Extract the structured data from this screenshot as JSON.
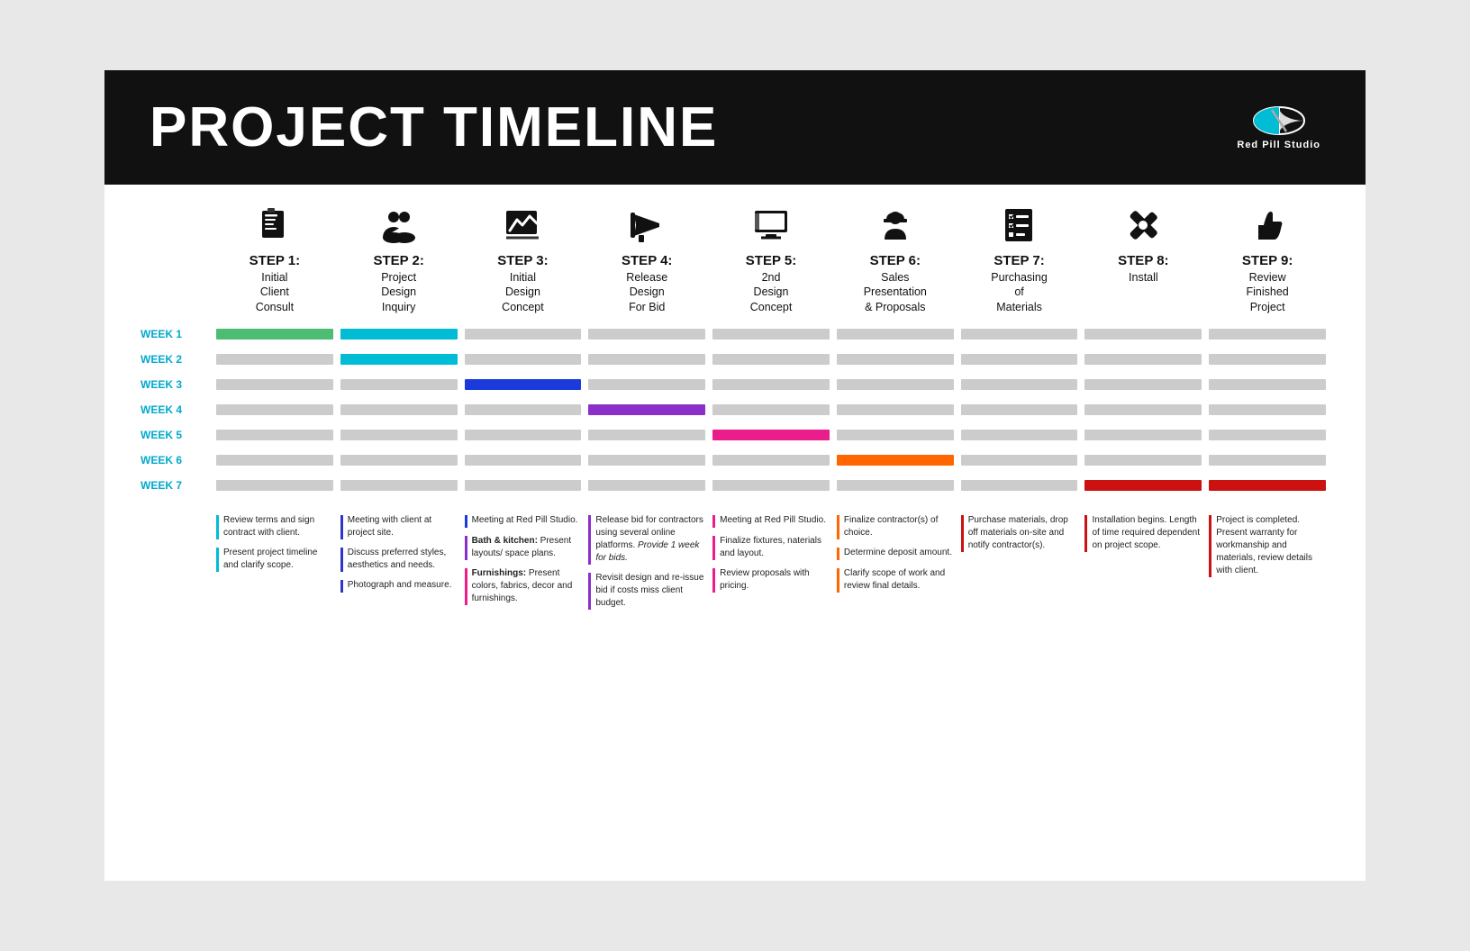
{
  "header": {
    "title": "PROJECT TIMELINE",
    "logo_text": "Red Pill Studio"
  },
  "steps": [
    {
      "id": "step1",
      "number": "STEP 1:",
      "title": "Initial\nClient\nConsult",
      "icon": "📋"
    },
    {
      "id": "step2",
      "number": "STEP 2:",
      "title": "Project\nDesign\nInquiry",
      "icon": "👥"
    },
    {
      "id": "step3",
      "number": "STEP 3:",
      "title": "Initial\nDesign\nConcept",
      "icon": "📈"
    },
    {
      "id": "step4",
      "number": "STEP 4:",
      "title": "Release\nDesign\nFor Bid",
      "icon": "📢"
    },
    {
      "id": "step5",
      "number": "STEP 5:",
      "title": "2nd\nDesign\nConcept",
      "icon": "🖥"
    },
    {
      "id": "step6",
      "number": "STEP 6:",
      "title": "Sales\nPresentation\n& Proposals",
      "icon": "👷"
    },
    {
      "id": "step7",
      "number": "STEP 7:",
      "title": "Purchasing\nof\nMaterials",
      "icon": "📋"
    },
    {
      "id": "step8",
      "number": "STEP 8:",
      "title": "Install",
      "icon": "🔧"
    },
    {
      "id": "step9",
      "number": "STEP 9:",
      "title": "Review\nFinished\nProject",
      "icon": "👍"
    }
  ],
  "weeks": [
    "WEEK 1",
    "WEEK 2",
    "WEEK 3",
    "WEEK 4",
    "WEEK 5",
    "WEEK 6",
    "WEEK 7"
  ],
  "timeline": {
    "week1": [
      "green",
      "teal",
      "gray",
      "gray",
      "gray",
      "gray",
      "gray",
      "gray",
      "gray"
    ],
    "week2": [
      "gray",
      "teal",
      "gray",
      "gray",
      "gray",
      "gray",
      "gray",
      "gray",
      "gray"
    ],
    "week3": [
      "gray",
      "gray",
      "blue",
      "gray",
      "gray",
      "gray",
      "gray",
      "gray",
      "gray"
    ],
    "week4": [
      "gray",
      "gray",
      "gray",
      "purple",
      "gray",
      "gray",
      "gray",
      "gray",
      "gray"
    ],
    "week5": [
      "gray",
      "gray",
      "gray",
      "gray",
      "pink",
      "gray",
      "gray",
      "gray",
      "gray"
    ],
    "week6": [
      "gray",
      "gray",
      "gray",
      "gray",
      "gray",
      "orange",
      "gray",
      "gray",
      "gray"
    ],
    "week7": [
      "gray",
      "gray",
      "gray",
      "gray",
      "gray",
      "gray",
      "gray",
      "red",
      "red"
    ]
  },
  "descriptions": [
    {
      "items": [
        {
          "color": "#00bcd4",
          "text": "Review terms and sign contract with client."
        },
        {
          "color": "#00bcd4",
          "text": "Present project timeline and clarify scope."
        }
      ]
    },
    {
      "items": [
        {
          "color": "#3333cc",
          "text": "Meeting with client at project site."
        },
        {
          "color": "#3333cc",
          "text": "Discuss preferred styles, aesthetics and needs."
        },
        {
          "color": "#3333cc",
          "text": "Photograph and measure."
        }
      ]
    },
    {
      "items": [
        {
          "color": "#1a3adb",
          "text": "Meeting at Red Pill Studio."
        },
        {
          "color": "#8b2fc9",
          "text": "<b>Bath & kitchen:</b> Present layouts/ space plans."
        },
        {
          "color": "#e91e8c",
          "text": "<b>Furnishings:</b> Present colors, fabrics, decor and furnishings."
        }
      ]
    },
    {
      "items": [
        {
          "color": "#8b2fc9",
          "text": "Release bid for contractors using several online platforms. <em>Provide 1 week for bids.</em>"
        },
        {
          "color": "#8b2fc9",
          "text": "Revisit design and re-issue bid if costs miss client budget."
        }
      ]
    },
    {
      "items": [
        {
          "color": "#e91e8c",
          "text": "Meeting at Red Pill Studio."
        },
        {
          "color": "#e91e8c",
          "text": "Finalize fixtures, naterials and layout."
        },
        {
          "color": "#e91e8c",
          "text": "Review proposals with pricing."
        }
      ]
    },
    {
      "items": [
        {
          "color": "#ff6600",
          "text": "Finalize contractor(s) of choice."
        },
        {
          "color": "#ff6600",
          "text": "Determine deposit amount."
        },
        {
          "color": "#ff6600",
          "text": "Clarify scope of work and review final details."
        }
      ]
    },
    {
      "items": [
        {
          "color": "#cc1111",
          "text": "Purchase materials, drop off materials on-site and notify contractor(s)."
        }
      ]
    },
    {
      "items": [
        {
          "color": "#cc1111",
          "text": "Installation begins. Length of time required dependent on project scope."
        }
      ]
    },
    {
      "items": [
        {
          "color": "#cc1111",
          "text": "Project is completed. Present warranty for workmanship and materials, review details with client."
        }
      ]
    }
  ]
}
